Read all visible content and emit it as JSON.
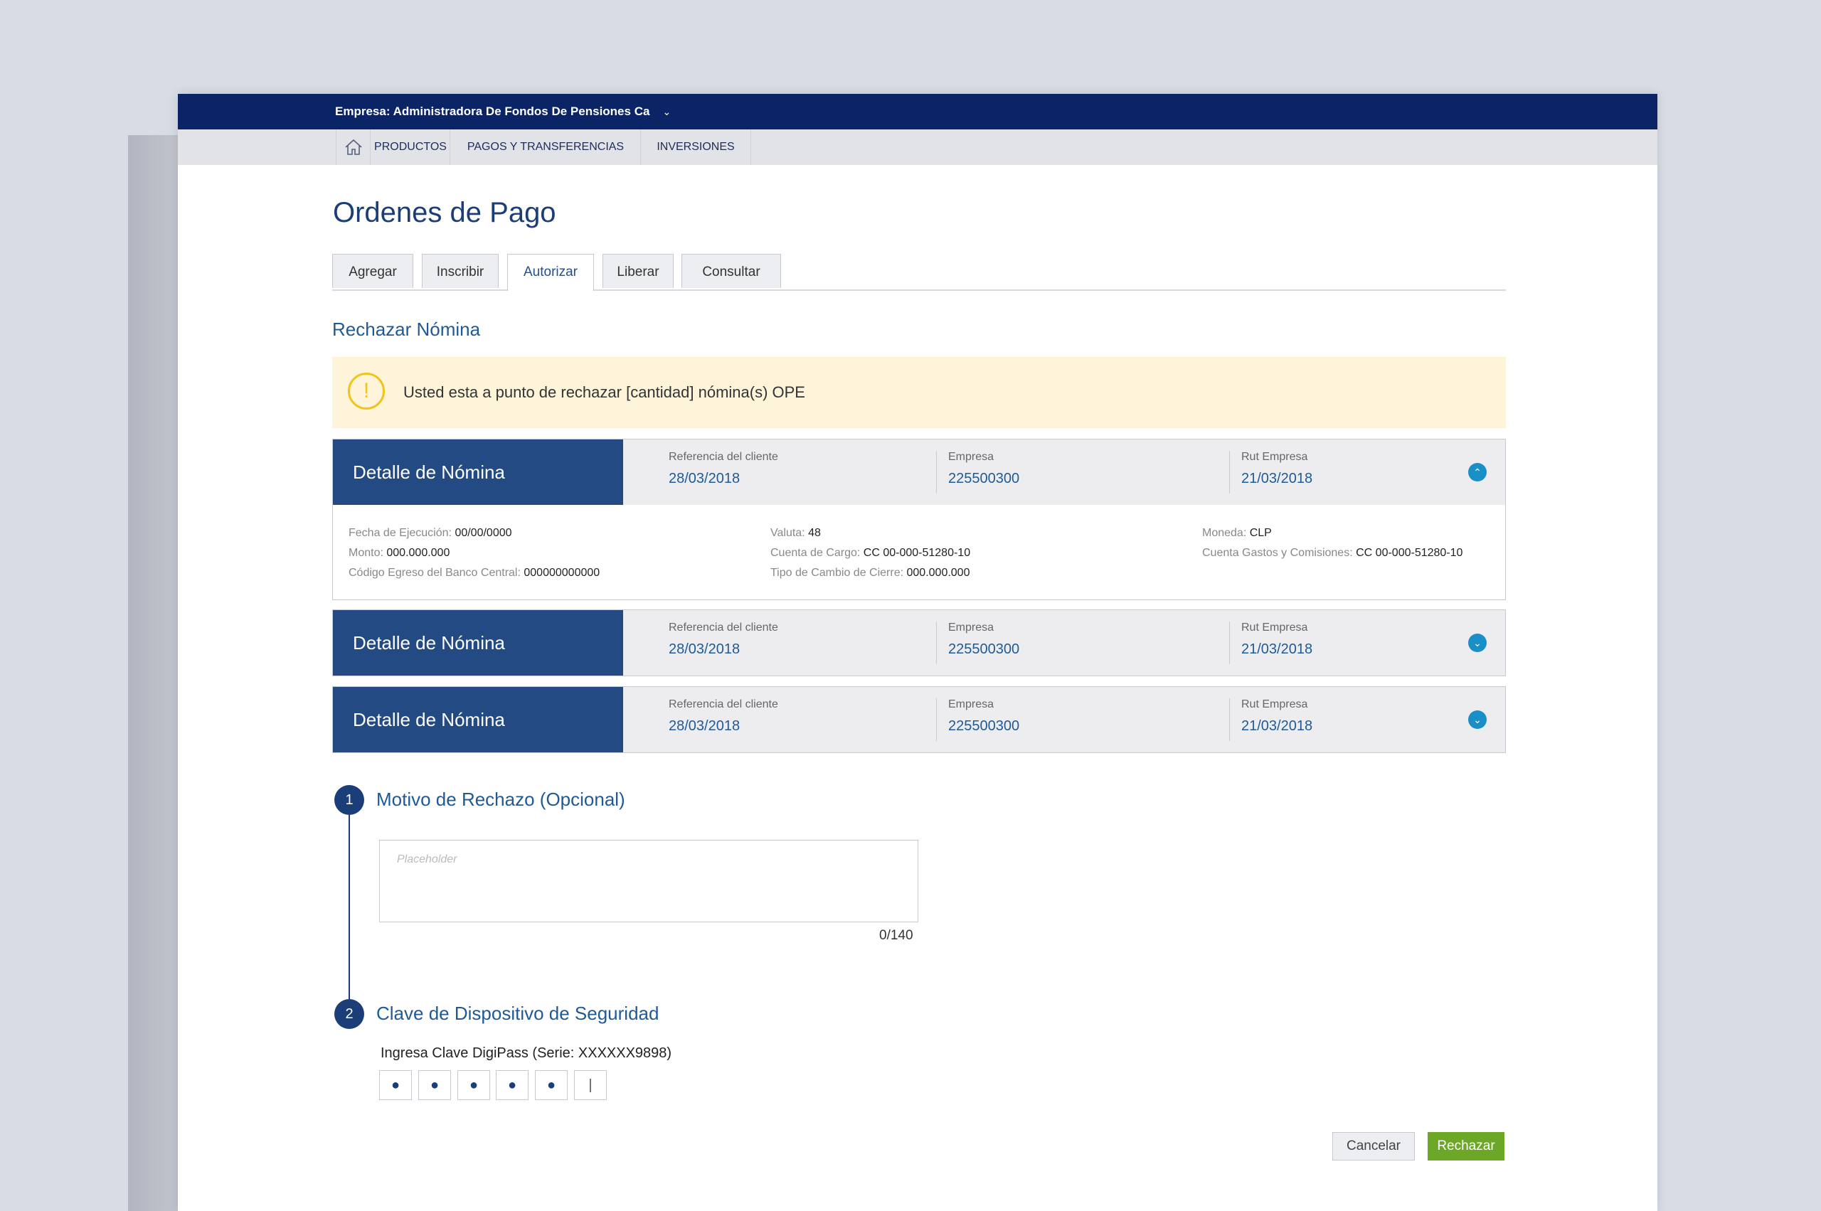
{
  "header": {
    "company": "Empresa: Administradora De Fondos De Pensiones Ca"
  },
  "nav": {
    "home_icon": "home-icon",
    "items": [
      "PRODUCTOS",
      "PAGOS Y TRANSFERENCIAS",
      "INVERSIONES"
    ]
  },
  "page": {
    "title": "Ordenes de Pago",
    "tabs": [
      "Agregar",
      "Inscribir",
      "Autorizar",
      "Liberar",
      "Consultar"
    ],
    "active_tab": "Autorizar",
    "section_title": "Rechazar Nómina"
  },
  "warning": {
    "icon": "warning-icon",
    "text": "Usted esta a punto de rechazar [cantidad] nómina(s) OPE"
  },
  "panels": [
    {
      "title": "Detalle de Nómina",
      "ref_label": "Referencia del cliente",
      "ref_value": "28/03/2018",
      "empresa_label": "Empresa",
      "empresa_value": "225500300",
      "rut_label": "Rut Empresa",
      "rut_value": "21/03/2018",
      "expanded": true,
      "details": {
        "fecha_label": "Fecha de Ejecución:",
        "fecha_value": "00/00/0000",
        "monto_label": "Monto:",
        "monto_value": "000.000.000",
        "codigo_label": "Código Egreso del Banco Central:",
        "codigo_value": "000000000000",
        "valuta_label": "Valuta:",
        "valuta_value": "48",
        "cuenta_cargo_label": "Cuenta de Cargo:",
        "cuenta_cargo_value": "CC 00-000-51280-10",
        "tipo_cambio_label": "Tipo de Cambio de Cierre:",
        "tipo_cambio_value": "000.000.000",
        "moneda_label": "Moneda:",
        "moneda_value": "CLP",
        "cuenta_gastos_label": "Cuenta Gastos y Comisiones:",
        "cuenta_gastos_value": "CC 00-000-51280-10"
      }
    },
    {
      "title": "Detalle de Nómina",
      "ref_label": "Referencia del cliente",
      "ref_value": "28/03/2018",
      "empresa_label": "Empresa",
      "empresa_value": "225500300",
      "rut_label": "Rut Empresa",
      "rut_value": "21/03/2018",
      "expanded": false
    },
    {
      "title": "Detalle de Nómina",
      "ref_label": "Referencia del cliente",
      "ref_value": "28/03/2018",
      "empresa_label": "Empresa",
      "empresa_value": "225500300",
      "rut_label": "Rut Empresa",
      "rut_value": "21/03/2018",
      "expanded": false
    }
  ],
  "step1": {
    "number": "1",
    "title": "Motivo de Rechazo (Opcional)",
    "placeholder": "Placeholder",
    "counter": "0/140"
  },
  "step2": {
    "number": "2",
    "title": "Clave de Dispositivo de Seguridad",
    "label": "Ingresa Clave DigiPass (Serie: XXXXXX9898)",
    "pins": [
      "●",
      "●",
      "●",
      "●",
      "●",
      "|"
    ]
  },
  "actions": {
    "cancel": "Cancelar",
    "reject": "Rechazar"
  },
  "colors": {
    "topbar": "#0b2466",
    "panel_header": "#234a83",
    "accent": "#1f5a96",
    "toggle": "#1a8fc7",
    "warning_bg": "#fdf4d9",
    "warning_icon": "#f0c419",
    "reject_button": "#6da728"
  }
}
